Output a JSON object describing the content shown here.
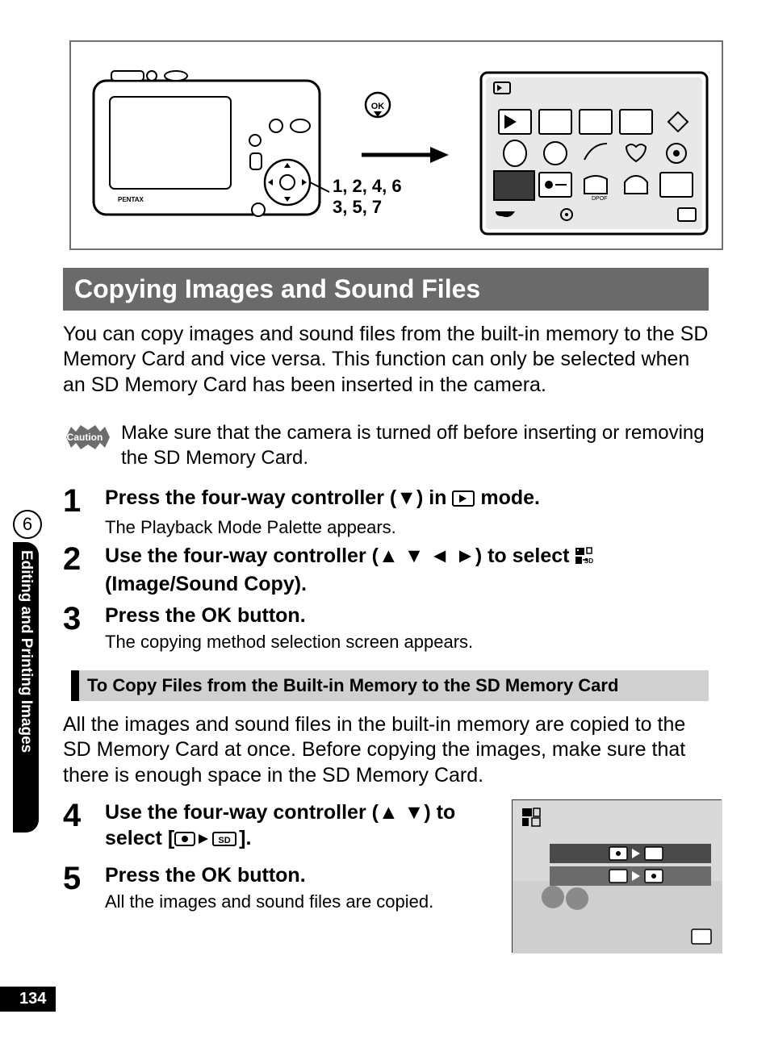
{
  "diagram": {
    "callout1": "1, 2, 4, 6",
    "callout2": "3, 5, 7",
    "ok_label": "OK",
    "camera_brand": "PENTAX"
  },
  "heading": "Copying Images and Sound Files",
  "intro": "You can copy images and sound files from the built-in memory to the SD Memory Card and vice versa. This function can only be selected when an SD Memory Card has been inserted in the camera.",
  "caution_label": "Caution",
  "caution_text": "Make sure that the camera is turned off before inserting or removing the SD Memory Card.",
  "steps": {
    "s1_num": "1",
    "s1_title_a": "Press the four-way controller (",
    "s1_title_b": ") in ",
    "s1_title_c": " mode.",
    "s1_sub": "The Playback Mode Palette appears.",
    "s2_num": "2",
    "s2_title_a": "Use the four-way controller (",
    "s2_title_b": ") to select ",
    "s2_title_c": " (Image/Sound Copy).",
    "s3_num": "3",
    "s3_title_a": "Press the ",
    "s3_title_b": " button.",
    "s3_ok": "OK",
    "s3_sub": "The copying method selection screen appears.",
    "s4_num": "4",
    "s4_title_a": "Use the four-way controller (",
    "s4_title_b": ") to select [",
    "s4_title_c": "].",
    "s5_num": "5",
    "s5_title_a": "Press the ",
    "s5_title_b": " button.",
    "s5_ok": "OK",
    "s5_sub": "All the images and sound files are copied."
  },
  "subheading": "To Copy Files from the Built-in Memory to the SD Memory Card",
  "sub_body": "All the images and sound files in the built-in memory are copied to the SD Memory Card at once. Before copying the images, make sure that there is enough space in the SD Memory Card.",
  "sidebar": {
    "chapter_num": "6",
    "chapter_title": "Editing and Printing Images"
  },
  "page_number": "134"
}
